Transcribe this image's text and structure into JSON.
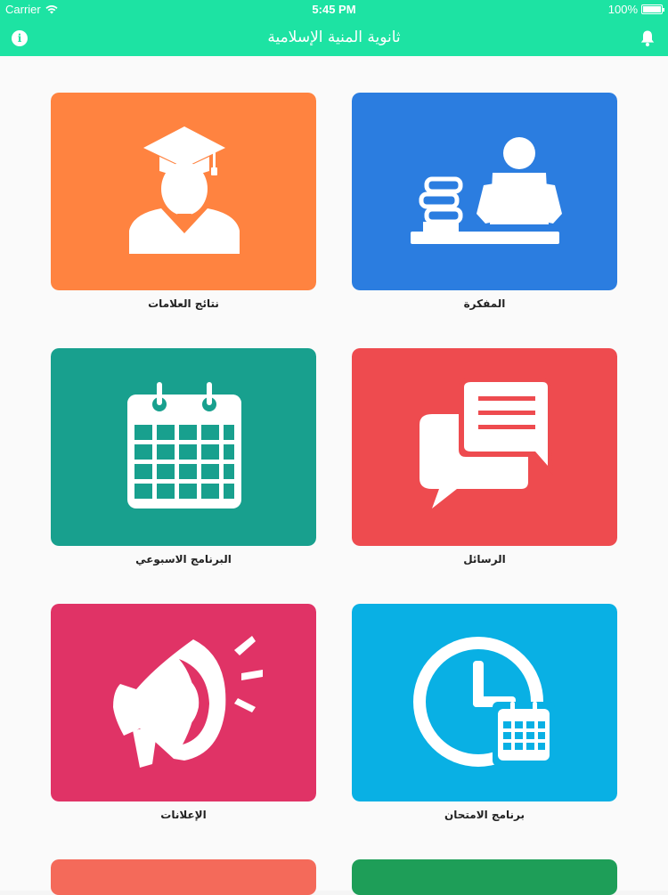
{
  "status_bar": {
    "carrier": "Carrier",
    "time": "5:45 PM",
    "battery": "100%"
  },
  "nav": {
    "title": "ثانوية المنية الإسلامية",
    "info_icon": "info-icon",
    "bell_icon": "bell-icon"
  },
  "tiles": [
    {
      "label": "المفكرة",
      "icon": "student-desk-icon",
      "color": "#2b7de0"
    },
    {
      "label": "نتائج العلامات",
      "icon": "graduate-icon",
      "color": "#ff8340"
    },
    {
      "label": "الرسائل",
      "icon": "chat-bubbles-icon",
      "color": "#ee4b4f"
    },
    {
      "label": "البرنامج الاسبوعي",
      "icon": "calendar-icon",
      "color": "#18a08e"
    },
    {
      "label": "برنامج الامتحان",
      "icon": "clock-calendar-icon",
      "color": "#09b0e4"
    },
    {
      "label": "الإعلانات",
      "icon": "megaphone-icon",
      "color": "#e03366"
    },
    {
      "label": "",
      "icon": "",
      "color": "#1e9e58"
    },
    {
      "label": "",
      "icon": "",
      "color": "#f46a5a"
    }
  ]
}
